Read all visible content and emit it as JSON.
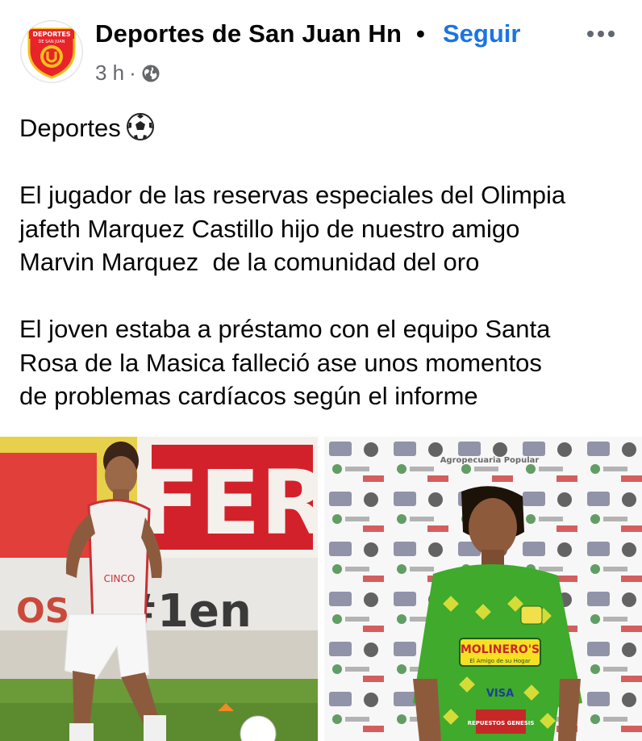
{
  "post": {
    "page_name": "Deportes de San Juan Hn",
    "separator": "•",
    "follow_label": "Seguir",
    "timestamp": "3 h",
    "meta_dot": "·",
    "privacy_icon": "globe-icon",
    "avatar_text": "DEPORTES",
    "avatar_subtext": "DE SAN JUAN",
    "text": {
      "line1": "Deportes",
      "para1": "El jugador de las reservas especiales del Olimpia\njafeth Marquez Castillo hijo de nuestro amigo\nMarvin Marquez  de la comunidad del oro",
      "para2": "El joven estaba a préstamo con el equipo Santa\nRosa de la Masica falleció ase unos momentos\nde problemas cardíacos según el informe"
    }
  },
  "photos": {
    "left": {
      "wall_text": "FER",
      "banner_text": "#1en",
      "side_text": "OS",
      "vest_text": "CINCO"
    },
    "right": {
      "shirt_text": "MOLINERO'S",
      "shirt_subtext": "El Amigo de su Hogar",
      "sponsor_bottom": "REPUESTOS GENESIS",
      "sponsor_mid": "VISA",
      "backdrop_top": "Agropecuaria Popular"
    }
  },
  "colors": {
    "follow": "#1b74e4",
    "text": "#050505",
    "meta": "#65676b",
    "shirt_green": "#3faa2c",
    "shirt_yellow": "#e6e23a",
    "wall_red": "#d2212a"
  }
}
